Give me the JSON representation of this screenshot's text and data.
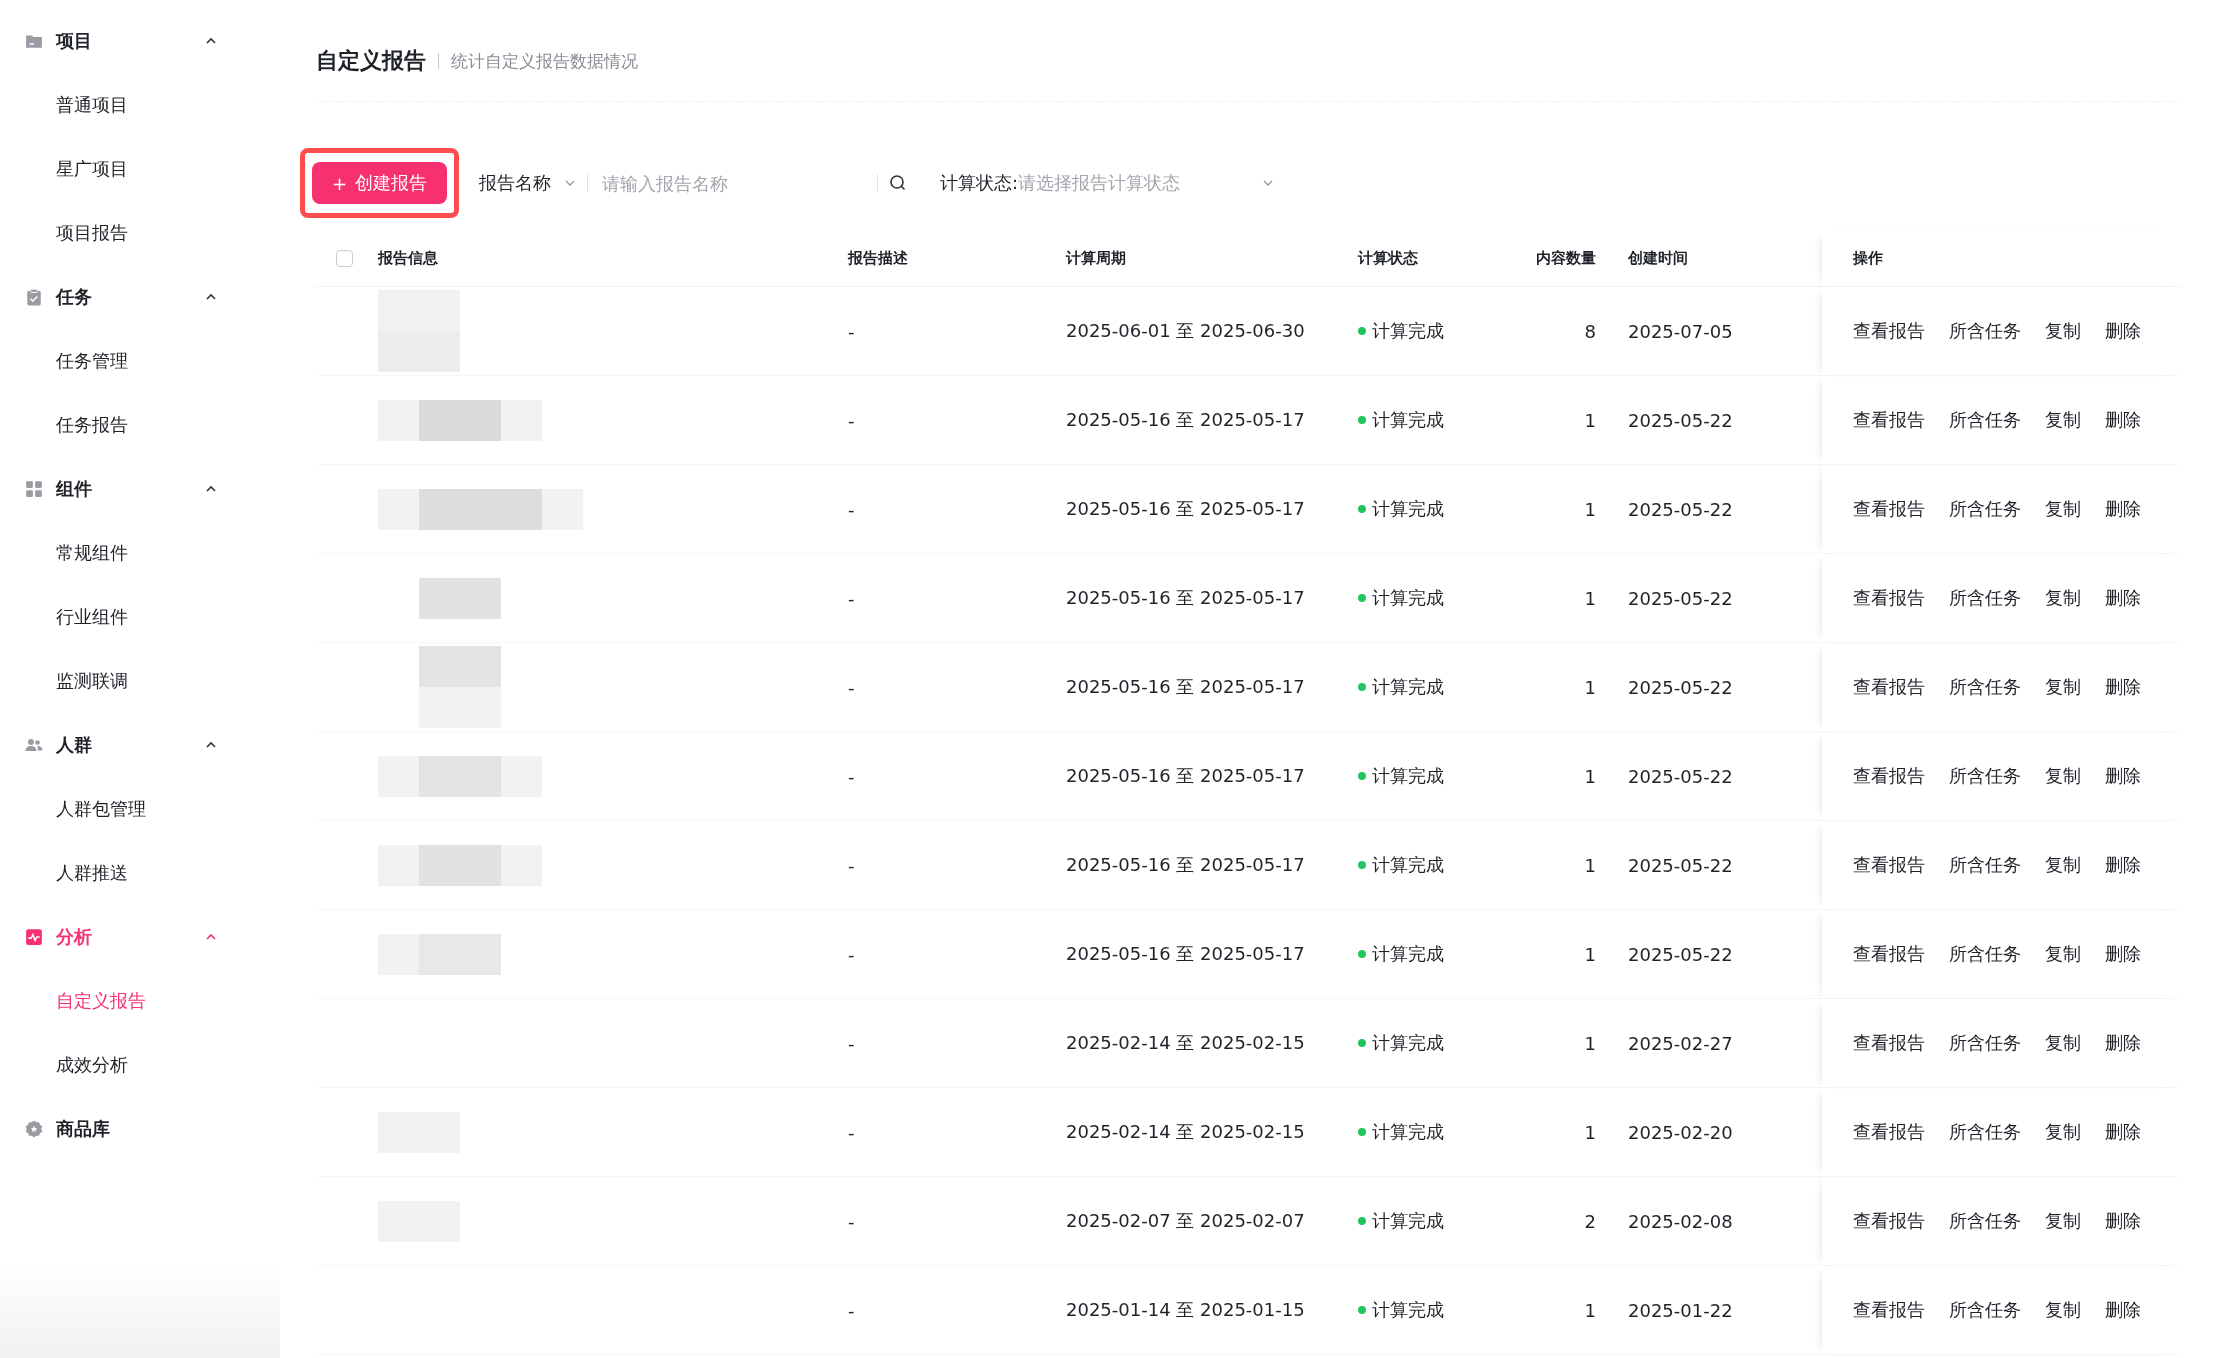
{
  "sidebar": {
    "groups": [
      {
        "label": "项目",
        "expanded": true,
        "selected": false,
        "items": [
          {
            "label": "普通项目",
            "selected": false
          },
          {
            "label": "星广项目",
            "selected": false
          },
          {
            "label": "项目报告",
            "selected": false
          }
        ]
      },
      {
        "label": "任务",
        "expanded": true,
        "selected": false,
        "items": [
          {
            "label": "任务管理",
            "selected": false
          },
          {
            "label": "任务报告",
            "selected": false
          }
        ]
      },
      {
        "label": "组件",
        "expanded": true,
        "selected": false,
        "items": [
          {
            "label": "常规组件",
            "selected": false
          },
          {
            "label": "行业组件",
            "selected": false
          },
          {
            "label": "监测联调",
            "selected": false
          }
        ]
      },
      {
        "label": "人群",
        "expanded": true,
        "selected": false,
        "items": [
          {
            "label": "人群包管理",
            "selected": false
          },
          {
            "label": "人群推送",
            "selected": false
          }
        ]
      },
      {
        "label": "分析",
        "expanded": true,
        "selected": true,
        "items": [
          {
            "label": "自定义报告",
            "selected": true
          },
          {
            "label": "成效分析",
            "selected": false
          }
        ]
      },
      {
        "label": "商品库",
        "selected": false
      }
    ]
  },
  "page": {
    "title": "自定义报告",
    "subtitle": "统计自定义报告数据情况"
  },
  "toolbar": {
    "create_button": {
      "icon": "+",
      "label": "创建报告",
      "highlighted": true
    },
    "search_type": "报告名称",
    "search": {
      "placeholder": "请输入报告名称"
    },
    "status_filter": {
      "label": "计算状态:",
      "placeholder": "请选择报告计算状态"
    }
  },
  "table": {
    "select_all": {
      "checked": false
    },
    "columns": [
      "报告信息",
      "报告描述",
      "计算周期",
      "计算状态",
      "内容数量",
      "创建时间",
      "操作"
    ],
    "rows": [
      {
        "description": "-",
        "period": "2025-06-01 至 2025-06-30",
        "status": "计算完成",
        "color": "#22c55e",
        "count": "8",
        "created": "2025-07-05",
        "actions": [
          "查看报告",
          "所含任务",
          "复制",
          "删除"
        ]
      },
      {
        "description": "-",
        "period": "2025-05-16 至 2025-05-17",
        "status": "计算完成",
        "color": "#22c55e",
        "count": "1",
        "created": "2025-05-22",
        "actions": [
          "查看报告",
          "所含任务",
          "复制",
          "删除"
        ]
      },
      {
        "description": "-",
        "period": "2025-05-16 至 2025-05-17",
        "status": "计算完成",
        "color": "#22c55e",
        "count": "1",
        "created": "2025-05-22",
        "actions": [
          "查看报告",
          "所含任务",
          "复制",
          "删除"
        ]
      },
      {
        "description": "-",
        "period": "2025-05-16 至 2025-05-17",
        "status": "计算完成",
        "color": "#22c55e",
        "count": "1",
        "created": "2025-05-22",
        "actions": [
          "查看报告",
          "所含任务",
          "复制",
          "删除"
        ]
      },
      {
        "description": "-",
        "period": "2025-05-16 至 2025-05-17",
        "status": "计算完成",
        "color": "#22c55e",
        "count": "1",
        "created": "2025-05-22",
        "actions": [
          "查看报告",
          "所含任务",
          "复制",
          "删除"
        ]
      },
      {
        "description": "-",
        "period": "2025-05-16 至 2025-05-17",
        "status": "计算完成",
        "color": "#22c55e",
        "count": "1",
        "created": "2025-05-22",
        "actions": [
          "查看报告",
          "所含任务",
          "复制",
          "删除"
        ]
      },
      {
        "description": "-",
        "period": "2025-05-16 至 2025-05-17",
        "status": "计算完成",
        "color": "#22c55e",
        "count": "1",
        "created": "2025-05-22",
        "actions": [
          "查看报告",
          "所含任务",
          "复制",
          "删除"
        ]
      },
      {
        "description": "-",
        "period": "2025-05-16 至 2025-05-17",
        "status": "计算完成",
        "color": "#22c55e",
        "count": "1",
        "created": "2025-05-22",
        "actions": [
          "查看报告",
          "所含任务",
          "复制",
          "删除"
        ]
      },
      {
        "description": "-",
        "period": "2025-02-14 至 2025-02-15",
        "status": "计算完成",
        "color": "#22c55e",
        "count": "1",
        "created": "2025-02-27",
        "actions": [
          "查看报告",
          "所含任务",
          "复制",
          "删除"
        ]
      },
      {
        "description": "-",
        "period": "2025-02-14 至 2025-02-15",
        "status": "计算完成",
        "color": "#22c55e",
        "count": "1",
        "created": "2025-02-20",
        "actions": [
          "查看报告",
          "所含任务",
          "复制",
          "删除"
        ]
      },
      {
        "description": "-",
        "period": "2025-02-07 至 2025-02-07",
        "status": "计算完成",
        "color": "#22c55e",
        "count": "2",
        "created": "2025-02-08",
        "actions": [
          "查看报告",
          "所含任务",
          "复制",
          "删除"
        ]
      },
      {
        "description": "-",
        "period": "2025-01-14 至 2025-01-15",
        "status": "计算完成",
        "color": "#22c55e",
        "count": "1",
        "created": "2025-01-22",
        "actions": [
          "查看报告",
          "所含任务",
          "复制",
          "删除"
        ]
      }
    ]
  }
}
